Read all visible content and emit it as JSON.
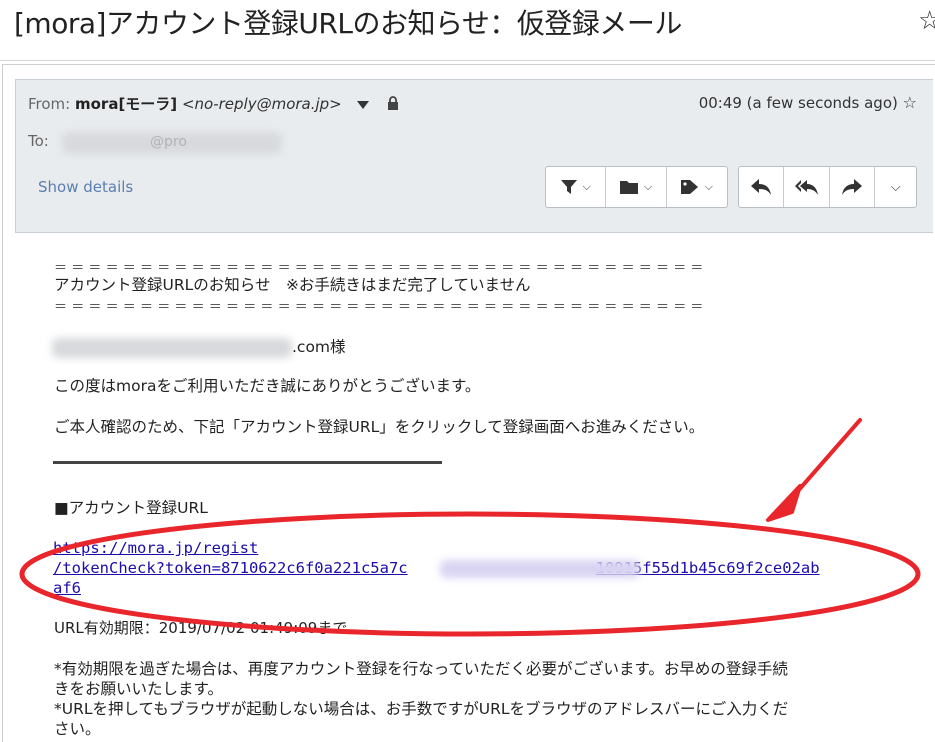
{
  "subject": "[mora]アカウント登録URLのお知らせ：仮登録メール",
  "header": {
    "from_label": "From:",
    "from_name": "mora[モーラ]",
    "from_address": "<no-reply@mora.jp>",
    "time": "00:49 (a few seconds ago)",
    "to_label": "To:",
    "to_partial": "@pro",
    "show_details": "Show details"
  },
  "toolbar": {
    "group1": [
      "filter-icon",
      "folder-icon",
      "tag-icon"
    ],
    "group2": [
      "reply-icon",
      "reply-all-icon",
      "forward-icon",
      "more-icon"
    ]
  },
  "body": {
    "rule_line": "＝＝＝＝＝＝＝＝＝＝＝＝＝＝＝＝＝＝＝＝＝＝＝＝＝＝＝＝＝＝＝＝＝＝＝＝＝＝",
    "heading": "アカウント登録URLのお知らせ　※お手続きはまだ完了していません",
    "recipient_suffix": ".com様",
    "thanks": "この度はmoraをご利用いただき誠にありがとうございます。",
    "instruction": "ご本人確認のため、下記「アカウント登録URL」をクリックして登録画面へお進みください。",
    "section_title": "■アカウント登録URL",
    "url_line1": "https://mora.jp/regist",
    "url_line2": "/tokenCheck?token=8710622c6f0a221c5a7c",
    "url_line2_tail": "10915f55d1b45c69f2ce02ab",
    "url_line3": "af6",
    "expiry": "URL有効期限：2019/07/02 01:49:09まで",
    "note1a": "*有効期限を過ぎた場合は、再度アカウント登録を行なっていただく必要がございます。お早めの登録手続",
    "note1b": "きをお願いいたします。",
    "note2a": "*URLを押してもブラウザが起動しない場合は、お手数ですがURLをブラウザのアドレスバーにご入力くだ",
    "note2b": "さい。"
  },
  "colors": {
    "annotation": "#e8262b",
    "link": "#1a0dab",
    "header_bg": "#e9ecef"
  }
}
